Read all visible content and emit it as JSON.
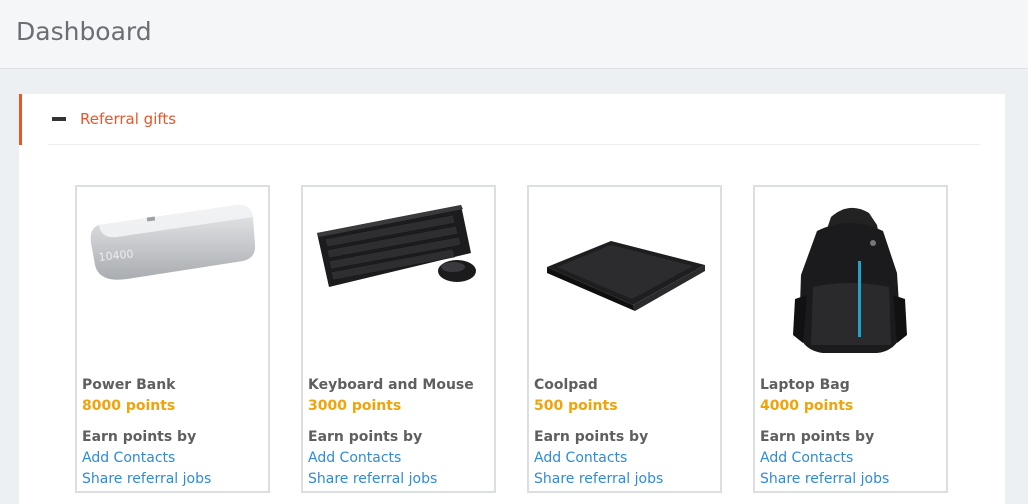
{
  "header": {
    "title": "Dashboard"
  },
  "panel": {
    "title": "Referral gifts",
    "toggle_icon": "minus-icon",
    "accent_color": "#e8572a"
  },
  "gifts": [
    {
      "name": "Power Bank",
      "points": "8000 points",
      "earn_label": "Earn points by",
      "link1": "Add Contacts",
      "link2": "Share referral jobs",
      "image": "power-bank-image"
    },
    {
      "name": "Keyboard and Mouse",
      "points": "3000 points",
      "earn_label": "Earn points by",
      "link1": "Add Contacts",
      "link2": "Share referral jobs",
      "image": "keyboard-mouse-image"
    },
    {
      "name": "Coolpad",
      "points": "500 points",
      "earn_label": "Earn points by",
      "link1": "Add Contacts",
      "link2": "Share referral jobs",
      "image": "coolpad-image"
    },
    {
      "name": "Laptop Bag",
      "points": "4000 points",
      "earn_label": "Earn points by",
      "link1": "Add Contacts",
      "link2": "Share referral jobs",
      "image": "laptop-bag-image"
    }
  ],
  "colors": {
    "points": "#f0a30a",
    "link": "#2f8bd6",
    "accent": "#e8572a"
  }
}
